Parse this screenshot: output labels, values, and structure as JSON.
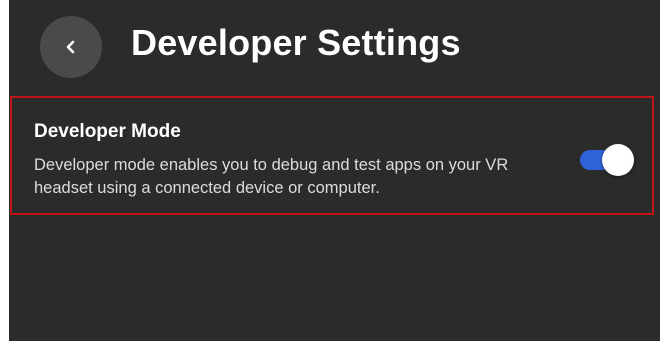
{
  "header": {
    "back_icon": "chevron-left-icon",
    "title": "Developer Settings"
  },
  "developer_mode": {
    "title": "Developer Mode",
    "description": "Developer mode enables you to debug and test apps on your VR headset using a connected device or computer.",
    "enabled": true
  },
  "colors": {
    "background": "#2b2b2b",
    "highlight_border": "#c0141b",
    "toggle_on": "#2f62d6",
    "back_button": "#4a4a4a"
  }
}
